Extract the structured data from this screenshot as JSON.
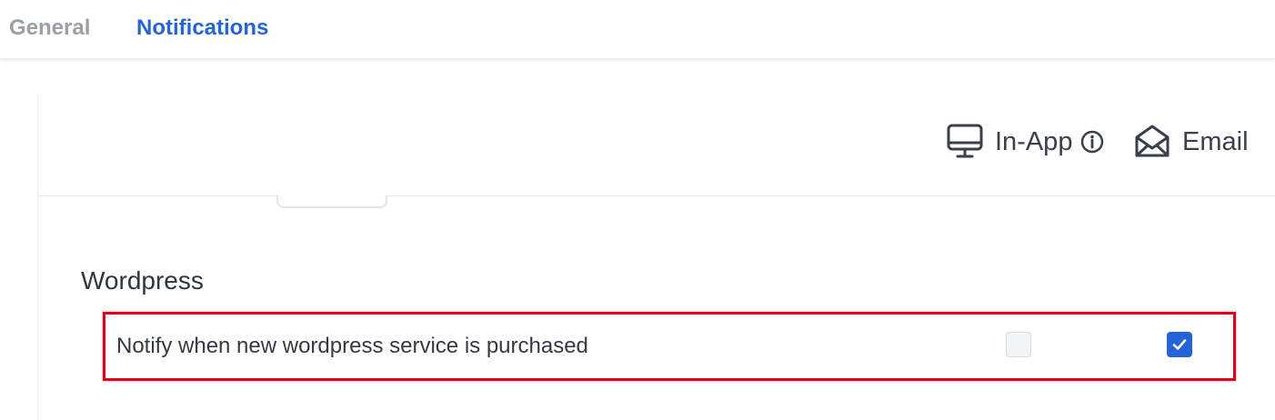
{
  "tabs": {
    "general": "General",
    "notifications": "Notifications",
    "active": "Notifications"
  },
  "channels": {
    "in_app": {
      "label": "In-App",
      "icon": "monitor-icon",
      "info_icon": "info-icon"
    },
    "email": {
      "label": "Email",
      "icon": "envelope-open-icon"
    }
  },
  "section": {
    "title": "Wordpress",
    "rows": [
      {
        "label": "Notify when new wordpress service is purchased",
        "in_app_checked": false,
        "email_checked": true
      }
    ]
  },
  "colors": {
    "accent": "#2563d9",
    "inactive_tab": "#9aa0a8",
    "highlight_border": "#e0001a"
  }
}
